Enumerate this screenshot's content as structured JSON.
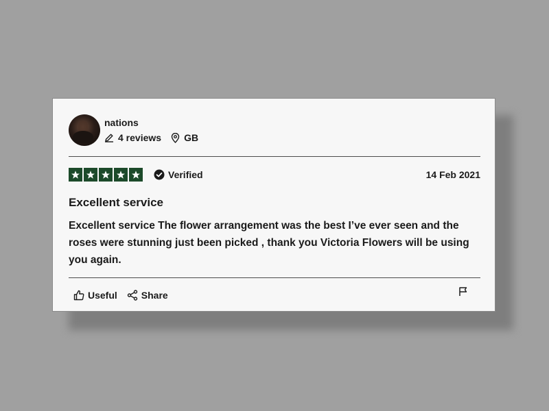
{
  "review": {
    "user": {
      "name": "nations",
      "reviews_count": "4 reviews",
      "country": "GB"
    },
    "rating": {
      "stars": 5,
      "max": 5,
      "verified_label": "Verified"
    },
    "date": "14 Feb 2021",
    "title": "Excellent service",
    "text": "Excellent service The flower arrangement was the best I’ve ever seen and the roses were stunning just been picked , thank you Victoria Flowers will be using you again.",
    "actions": {
      "useful_label": "Useful",
      "share_label": "Share"
    }
  },
  "icons": {
    "edit": "pencil-icon",
    "location": "location-pin-icon",
    "verified": "check-circle-icon",
    "useful": "thumbs-up-icon",
    "share": "share-icon",
    "flag": "flag-icon"
  },
  "colors": {
    "star_background": "#1c4a2a",
    "card_background": "#f7f7f7",
    "page_background": "#a0a0a0"
  }
}
